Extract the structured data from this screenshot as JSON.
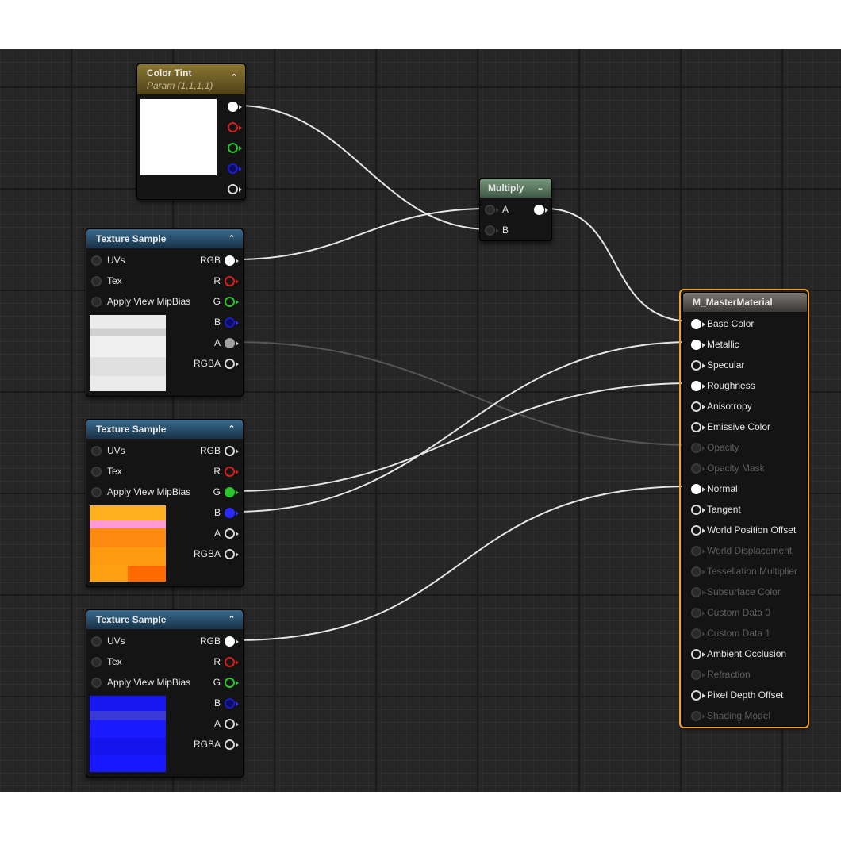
{
  "nodes": {
    "color_tint": {
      "title": "Color Tint",
      "subtitle": "Param (1,1,1,1)",
      "swatch_color": "#ffffff"
    },
    "multiply": {
      "title": "Multiply",
      "inputs": [
        "A",
        "B"
      ]
    },
    "tex1": {
      "title": "Texture Sample",
      "inputs": [
        "UVs",
        "Tex",
        "Apply View MipBias"
      ],
      "outputs": [
        "RGB",
        "R",
        "G",
        "B",
        "A",
        "RGBA"
      ]
    },
    "tex2": {
      "title": "Texture Sample",
      "inputs": [
        "UVs",
        "Tex",
        "Apply View MipBias"
      ],
      "outputs": [
        "RGB",
        "R",
        "G",
        "B",
        "A",
        "RGBA"
      ]
    },
    "tex3": {
      "title": "Texture Sample",
      "inputs": [
        "UVs",
        "Tex",
        "Apply View MipBias"
      ],
      "outputs": [
        "RGB",
        "R",
        "G",
        "B",
        "A",
        "RGBA"
      ]
    },
    "master": {
      "title": "M_MasterMaterial",
      "inputs": [
        "Base Color",
        "Metallic",
        "Specular",
        "Roughness",
        "Anisotropy",
        "Emissive Color",
        "Opacity",
        "Opacity Mask",
        "Normal",
        "Tangent",
        "World Position Offset",
        "World Displacement",
        "Tessellation Multiplier",
        "Subsurface Color",
        "Custom Data 0",
        "Custom Data 1",
        "Ambient Occlusion",
        "Refraction",
        "Pixel Depth Offset",
        "Shading Model"
      ]
    }
  },
  "colors": {
    "selection_outline": "#f0a030",
    "wire": "#e8e8e8",
    "pin_red": "#d42020",
    "pin_green": "#2cc42c",
    "pin_blue": "#2a2aff"
  },
  "icons": {
    "collapse": "chevron-up-icon",
    "expand": "chevron-down-icon"
  }
}
